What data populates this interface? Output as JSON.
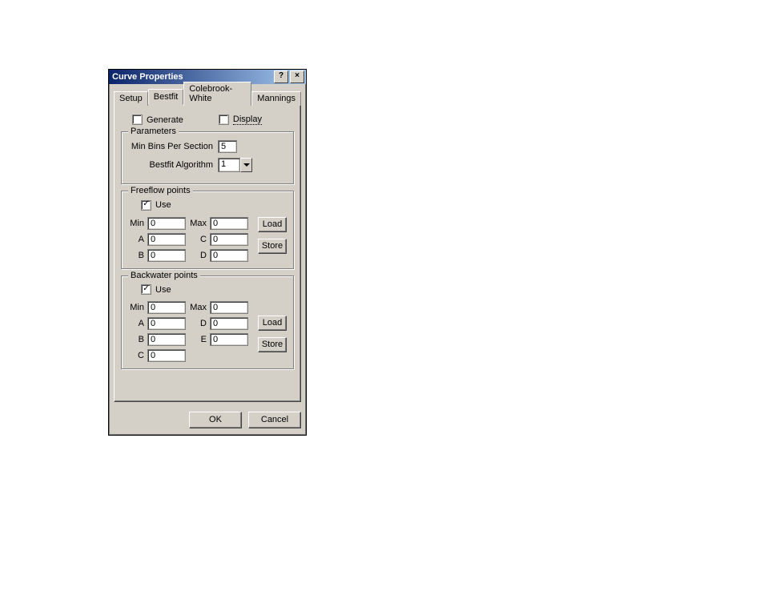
{
  "dialog": {
    "title": "Curve Properties",
    "help_label": "?",
    "close_label": "×"
  },
  "tabs": {
    "setup": "Setup",
    "bestfit": "Bestfit",
    "colebrook": "Colebrook-White",
    "mannings": "Mannings"
  },
  "bestfit": {
    "generate_label": "Generate",
    "display_label": "Display",
    "parameters": {
      "legend": "Parameters",
      "min_bins_label": "Min Bins Per Section",
      "min_bins_value": "5",
      "algo_label": "Bestfit Algorithm",
      "algo_value": "1"
    },
    "freeflow": {
      "legend": "Freeflow points",
      "use_label": "Use",
      "labels": {
        "min": "Min",
        "max": "Max",
        "a": "A",
        "b": "B",
        "c": "C",
        "d": "D"
      },
      "values": {
        "min": "0",
        "max": "0",
        "a": "0",
        "b": "0",
        "c": "0",
        "d": "0"
      },
      "load_label": "Load",
      "store_label": "Store"
    },
    "backwater": {
      "legend": "Backwater points",
      "use_label": "Use",
      "labels": {
        "min": "Min",
        "max": "Max",
        "a": "A",
        "b": "B",
        "c": "C",
        "d": "D",
        "e": "E"
      },
      "values": {
        "min": "0",
        "max": "0",
        "a": "0",
        "b": "0",
        "c": "0",
        "d": "0",
        "e": "0"
      },
      "load_label": "Load",
      "store_label": "Store"
    }
  },
  "footer": {
    "ok": "OK",
    "cancel": "Cancel"
  }
}
